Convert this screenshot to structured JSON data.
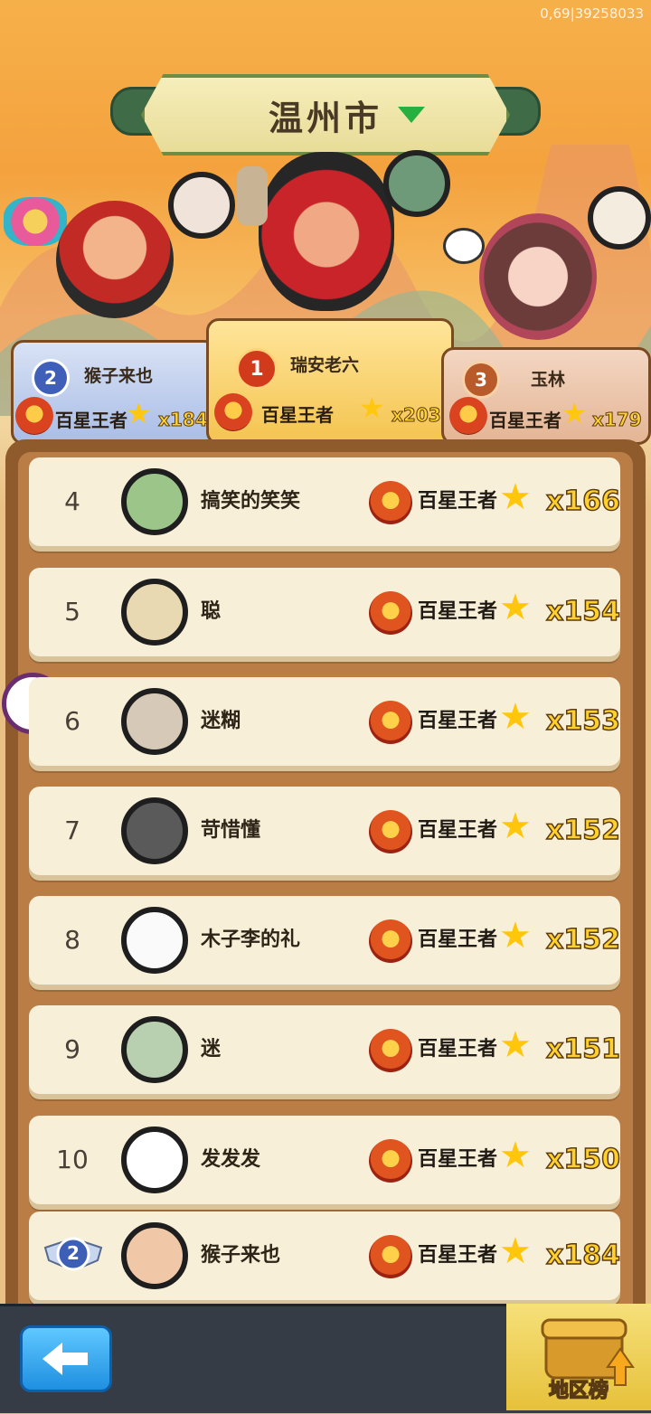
{
  "debug_text": "0,69|39258033",
  "city": {
    "name": "温州市"
  },
  "podium": [
    {
      "rank": "1",
      "name": "瑞安老六",
      "title": "百星王者",
      "count": "x203"
    },
    {
      "rank": "2",
      "name": "猴子来也",
      "title": "百星王者",
      "count": "x184"
    },
    {
      "rank": "3",
      "name": "玉林",
      "title": "百星王者",
      "count": "x179"
    }
  ],
  "rows": [
    {
      "rank": "4",
      "name": "搞笑的笑笑",
      "title": "百星王者",
      "count": "x166"
    },
    {
      "rank": "5",
      "name": "聪",
      "title": "百星王者",
      "count": "x154"
    },
    {
      "rank": "6",
      "name": "迷糊",
      "title": "百星王者",
      "count": "x153"
    },
    {
      "rank": "7",
      "name": "苛惜懂",
      "title": "百星王者",
      "count": "x152"
    },
    {
      "rank": "8",
      "name": "木子李的礼",
      "title": "百星王者",
      "count": "x152"
    },
    {
      "rank": "9",
      "name": "迷",
      "title": "百星王者",
      "count": "x151"
    },
    {
      "rank": "10",
      "name": "发发发",
      "title": "百星王者",
      "count": "x150"
    }
  ],
  "self_row": {
    "rank": "2",
    "name": "猴子来也",
    "title": "百星王者",
    "count": "x184"
  },
  "bottom": {
    "region_label": "地区榜"
  },
  "colors": {
    "gold": "#ffd12a",
    "board": "#8f5a2c",
    "banner_green": "#27b03f"
  }
}
